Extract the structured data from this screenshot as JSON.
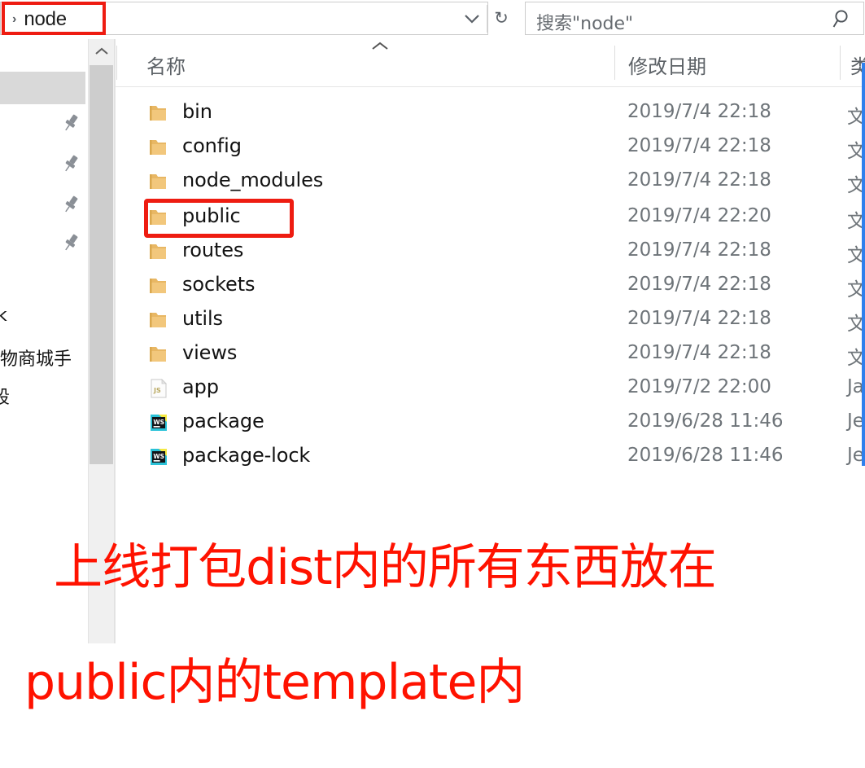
{
  "window": {
    "type": "file-explorer"
  },
  "toolbar": {
    "breadcrumb": {
      "separator": "›",
      "current_folder": "node"
    },
    "dropdown_icon": "chevron-down-icon",
    "refresh_icon": "refresh-icon",
    "refresh_glyph": "↻",
    "search": {
      "placeholder": "搜索\"node\"",
      "icon": "search-icon"
    }
  },
  "nav_pane": {
    "pins": [
      "pin-icon",
      "pin-icon",
      "pin-icon",
      "pin-icon"
    ],
    "clipped_texts": [
      "k",
      "购物商城手",
      "段"
    ]
  },
  "scrollbar": {
    "up_arrow_glyph": "⌃"
  },
  "columns": [
    {
      "label": "名称",
      "key": "name"
    },
    {
      "label": "修改日期",
      "key": "date"
    },
    {
      "label": "类",
      "key": "type"
    }
  ],
  "sort": {
    "column": "名称",
    "direction": "ascending",
    "indicator_glyph": "⌃"
  },
  "files": [
    {
      "name": "bin",
      "icon": "folder-icon",
      "date": "2019/7/4 22:18",
      "type": "文"
    },
    {
      "name": "config",
      "icon": "folder-icon",
      "date": "2019/7/4 22:18",
      "type": "文"
    },
    {
      "name": "node_modules",
      "icon": "folder-icon",
      "date": "2019/7/4 22:18",
      "type": "文"
    },
    {
      "name": "public",
      "icon": "folder-icon",
      "date": "2019/7/4 22:20",
      "type": "文"
    },
    {
      "name": "routes",
      "icon": "folder-icon",
      "date": "2019/7/4 22:18",
      "type": "文"
    },
    {
      "name": "sockets",
      "icon": "folder-icon",
      "date": "2019/7/4 22:18",
      "type": "文"
    },
    {
      "name": "utils",
      "icon": "folder-icon",
      "date": "2019/7/4 22:18",
      "type": "文"
    },
    {
      "name": "views",
      "icon": "folder-icon",
      "date": "2019/7/4 22:18",
      "type": "文"
    },
    {
      "name": "app",
      "icon": "js-file-icon",
      "date": "2019/7/2 22:00",
      "type": "Ja"
    },
    {
      "name": "package",
      "icon": "webstorm-icon",
      "date": "2019/6/28 11:46",
      "type": "Je"
    },
    {
      "name": "package-lock",
      "icon": "webstorm-icon",
      "date": "2019/6/28 11:46",
      "type": "Je"
    }
  ],
  "annotation": {
    "line1": "上线打包dist内的所有东西放在",
    "line2": "public内的template内",
    "color": "#ff1200"
  },
  "highlights": {
    "address_box_color": "#ee1c11",
    "public_box_color": "#ee1c11"
  }
}
